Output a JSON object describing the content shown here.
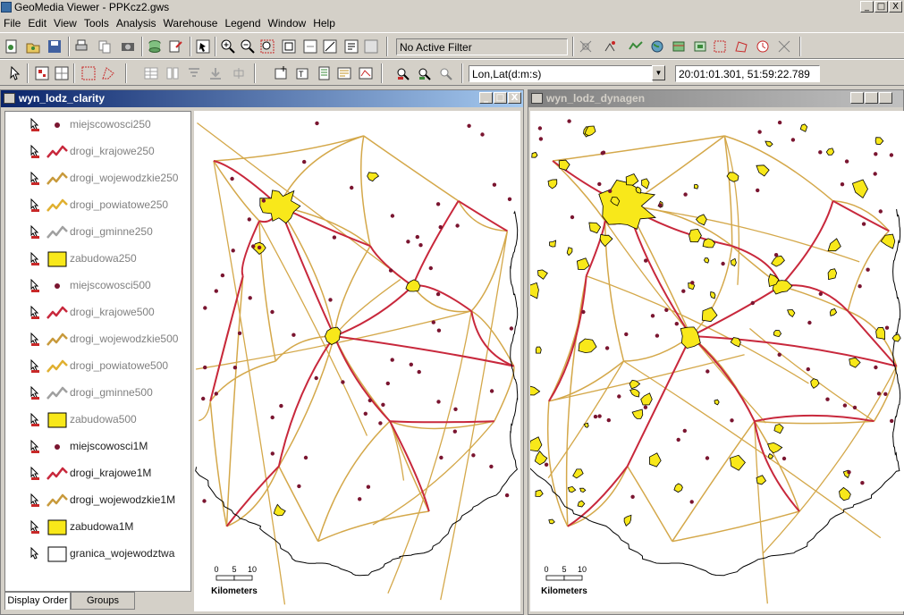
{
  "window": {
    "title": "GeoMedia Viewer - PPKcz2.gws",
    "buttons": [
      "_",
      "□",
      "X"
    ]
  },
  "menu": [
    "File",
    "Edit",
    "View",
    "Tools",
    "Analysis",
    "Warehouse",
    "Legend",
    "Window",
    "Help"
  ],
  "toolbar": {
    "filter_value": "No Active Filter",
    "coord_system": "Lon,Lat(d:m:s)",
    "coord_readout": "20:01:01.301, 51:59:22.789"
  },
  "left_window": {
    "title": "wyn_lodz_clarity"
  },
  "right_window": {
    "title": "wyn_lodz_dynagen"
  },
  "legend": {
    "items": [
      {
        "label": "miejscowosci250",
        "symbol": "point",
        "color": "#7a1530"
      },
      {
        "label": "drogi_krajowe250",
        "symbol": "line",
        "color": "#c8283c"
      },
      {
        "label": "drogi_wojewodzkie250",
        "symbol": "line",
        "color": "#c89a3c"
      },
      {
        "label": "drogi_powiatowe250",
        "symbol": "line",
        "color": "#e0b030"
      },
      {
        "label": "drogi_gminne250",
        "symbol": "line",
        "color": "#a0a0a0"
      },
      {
        "label": "zabudowa250",
        "symbol": "area",
        "color": "#f8e81a"
      },
      {
        "label": "miejscowosci500",
        "symbol": "point",
        "color": "#7a1530"
      },
      {
        "label": "drogi_krajowe500",
        "symbol": "line",
        "color": "#c8283c"
      },
      {
        "label": "drogi_wojewodzkie500",
        "symbol": "line",
        "color": "#c89a3c"
      },
      {
        "label": "drogi_powiatowe500",
        "symbol": "line",
        "color": "#e0b030"
      },
      {
        "label": "drogi_gminne500",
        "symbol": "line",
        "color": "#a0a0a0"
      },
      {
        "label": "zabudowa500",
        "symbol": "area",
        "color": "#f8e81a"
      },
      {
        "label": "miejscowosci1M",
        "symbol": "point",
        "color": "#7a1530"
      },
      {
        "label": "drogi_krajowe1M",
        "symbol": "line",
        "color": "#c8283c"
      },
      {
        "label": "drogi_wojewodzkie1M",
        "symbol": "line",
        "color": "#c89a3c"
      },
      {
        "label": "zabudowa1M",
        "symbol": "area",
        "color": "#f8e81a"
      },
      {
        "label": "granica_wojewodztwa",
        "symbol": "area",
        "color": "#ffffff"
      }
    ],
    "active_from": 12,
    "tabs": [
      "Display Order",
      "Groups"
    ]
  },
  "scalebar": {
    "ticks": [
      "0",
      "5",
      "10"
    ],
    "unit": "Kilometers"
  },
  "colors": {
    "national_road": "#c8283c",
    "regional_road": "#d4a84a",
    "builtup": "#f8e81a",
    "settlement": "#7a1530",
    "border": "#000000",
    "titlebar_active": "#0a246a"
  }
}
